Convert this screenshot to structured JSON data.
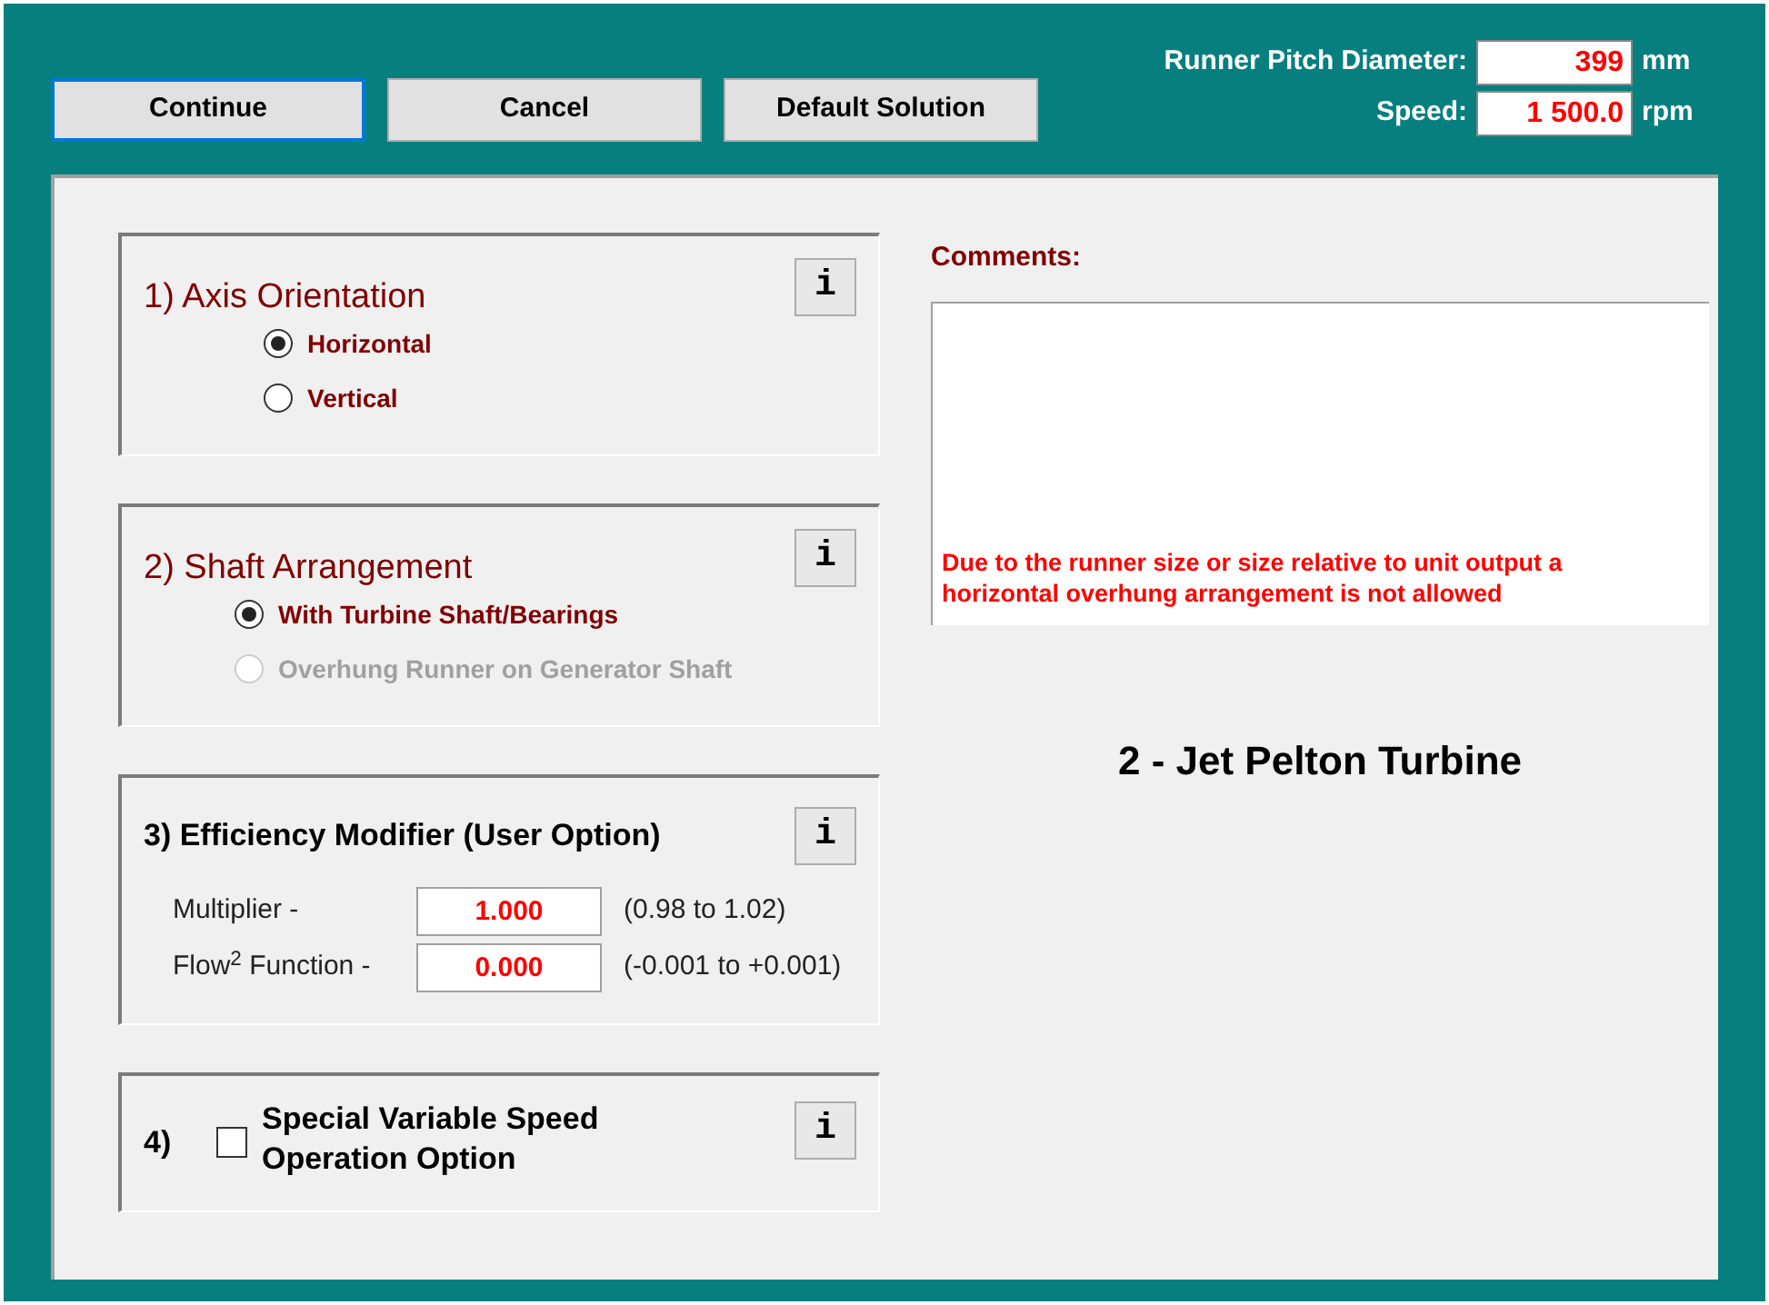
{
  "buttons": [
    {
      "label": "Continue",
      "selected": true
    },
    {
      "label": "Cancel",
      "selected": false
    },
    {
      "label": "Default Solution",
      "selected": false
    }
  ],
  "header_fields": [
    {
      "label": "Runner Pitch Diameter:",
      "value": "399",
      "unit": "mm"
    },
    {
      "label": "Speed:",
      "value": "1 500.0",
      "unit": "rpm"
    }
  ],
  "sections": [
    {
      "kind": "radio",
      "title": "1) Axis Orientation",
      "info": "i",
      "options": [
        {
          "label": "Horizontal",
          "selected": true,
          "disabled": false
        },
        {
          "label": "Vertical",
          "selected": false,
          "disabled": false
        }
      ]
    },
    {
      "kind": "radio",
      "title": "2) Shaft Arrangement",
      "info": "i",
      "options": [
        {
          "label": "With Turbine Shaft/Bearings",
          "selected": true,
          "disabled": false
        },
        {
          "label": "Overhung Runner on Generator Shaft",
          "selected": false,
          "disabled": true
        }
      ]
    },
    {
      "kind": "fields",
      "title": "3) Efficiency Modifier (User Option)",
      "info": "i",
      "fields": [
        {
          "label": "Multiplier -",
          "value": "1.000",
          "range": "(0.98 to 1.02)"
        },
        {
          "label": "Flow$^{2}$ Function -",
          "value": "0.000",
          "range": "(-0.001 to +0.001)"
        }
      ]
    },
    {
      "kind": "checkbox",
      "number": "4)",
      "title": "Special Variable Speed Operation Option",
      "checked": false,
      "info": "i"
    }
  ],
  "comments": {
    "label": "Comments:",
    "text": "Due to the runner size or size relative to unit output a horizontal overhung arrangement is not allowed"
  },
  "turbine_title": "2 - Jet Pelton Turbine"
}
